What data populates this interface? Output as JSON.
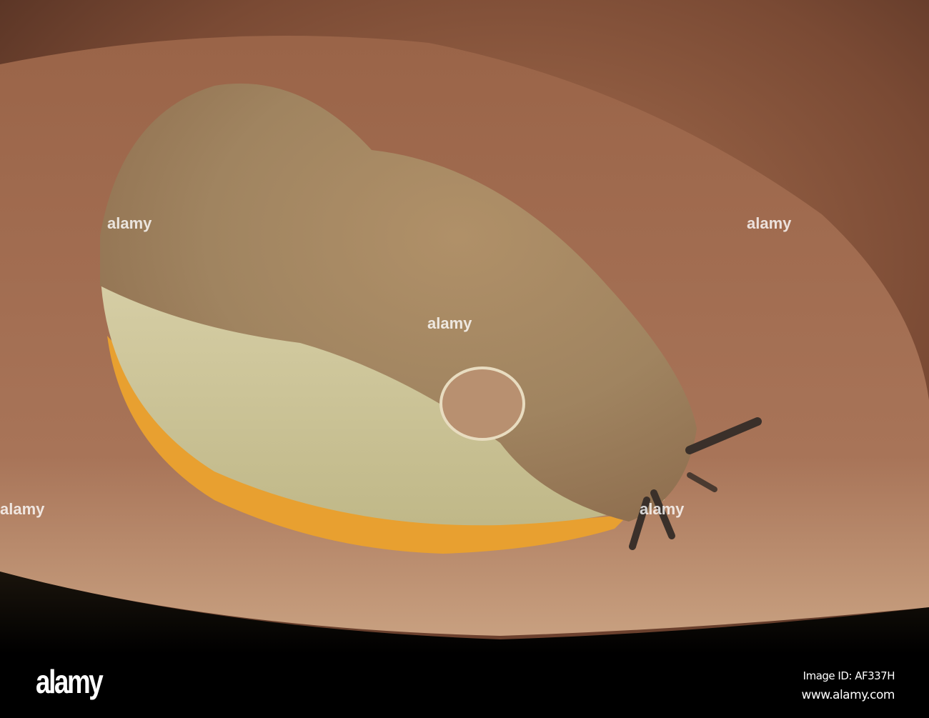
{
  "image": {
    "subject": "slug-on-mushroom",
    "colors": {
      "mushroom": "#8a5a3c",
      "slug_body": "#b89868",
      "slug_foot": "#e8a030",
      "background": "#000000"
    }
  },
  "watermark": {
    "logo": "alamy",
    "image_id": "Image ID: AF337H",
    "website": "www.alamy.com",
    "overlay_text": "alamy"
  }
}
